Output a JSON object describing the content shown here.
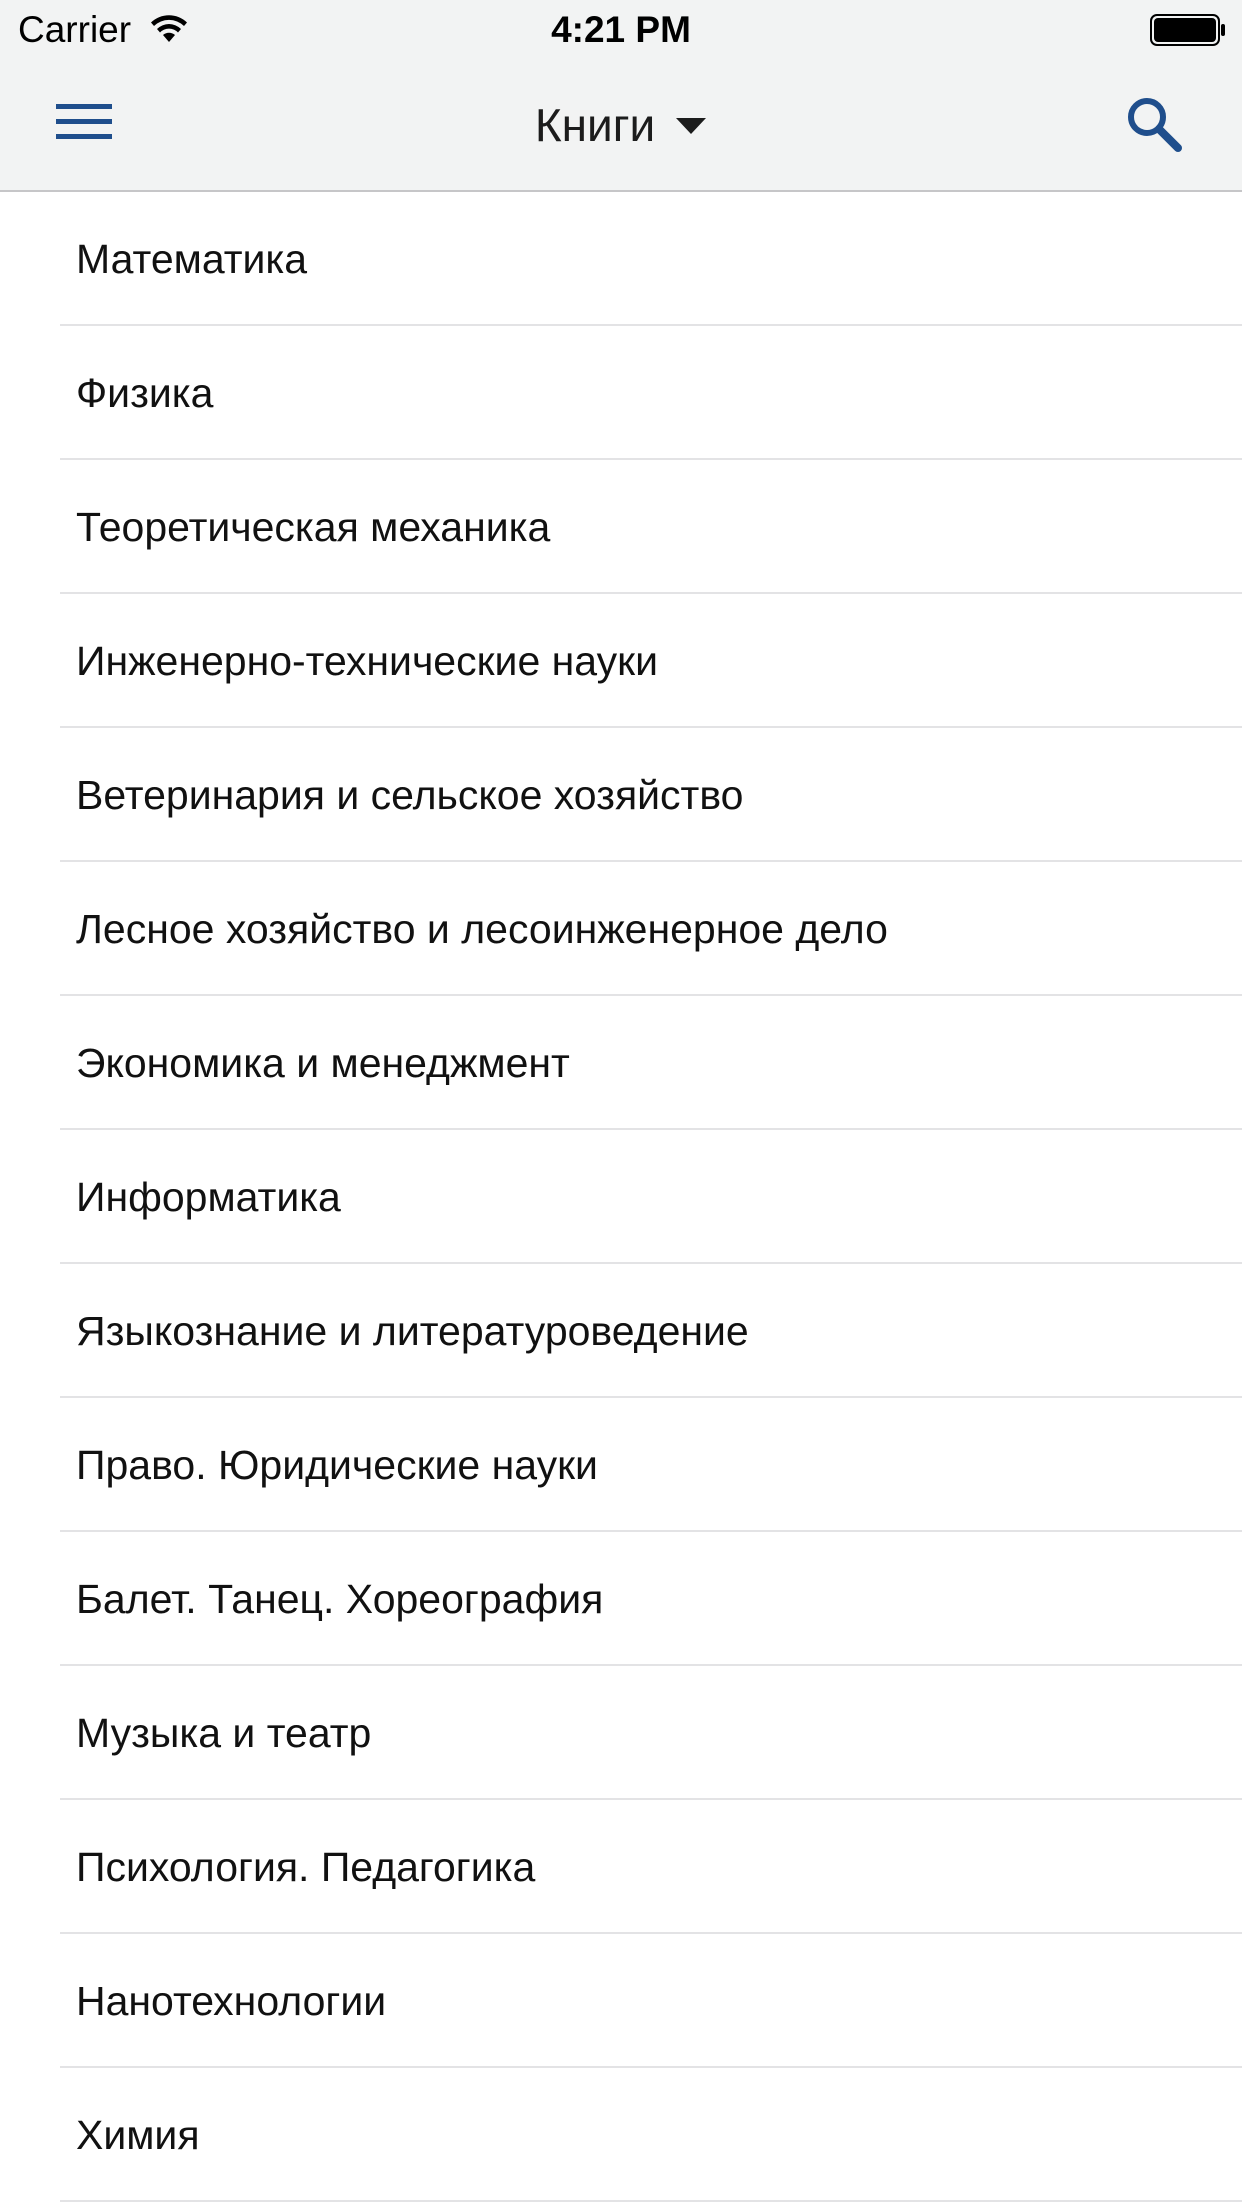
{
  "status_bar": {
    "carrier": "Carrier",
    "time": "4:21 PM",
    "wifi_icon": "wifi-icon",
    "battery_icon": "battery-full-icon"
  },
  "nav_bar": {
    "title": "Книги",
    "menu_icon": "hamburger-menu-icon",
    "dropdown_icon": "chevron-down-icon",
    "search_icon": "search-icon",
    "accent_color": "#1f4e8c",
    "background": "#f2f3f3"
  },
  "categories": [
    {
      "label": "Математика"
    },
    {
      "label": "Физика"
    },
    {
      "label": "Теоретическая механика"
    },
    {
      "label": "Инженерно-технические науки"
    },
    {
      "label": "Ветеринария и сельское хозяйство"
    },
    {
      "label": "Лесное хозяйство и лесоинженерное дело"
    },
    {
      "label": "Экономика и менеджмент"
    },
    {
      "label": "Информатика"
    },
    {
      "label": "Языкознание и литературоведение"
    },
    {
      "label": "Право. Юридические науки"
    },
    {
      "label": "Балет. Танец. Хореография"
    },
    {
      "label": "Музыка и театр"
    },
    {
      "label": "Психология. Педагогика"
    },
    {
      "label": "Нанотехнологии"
    },
    {
      "label": "Химия"
    }
  ]
}
